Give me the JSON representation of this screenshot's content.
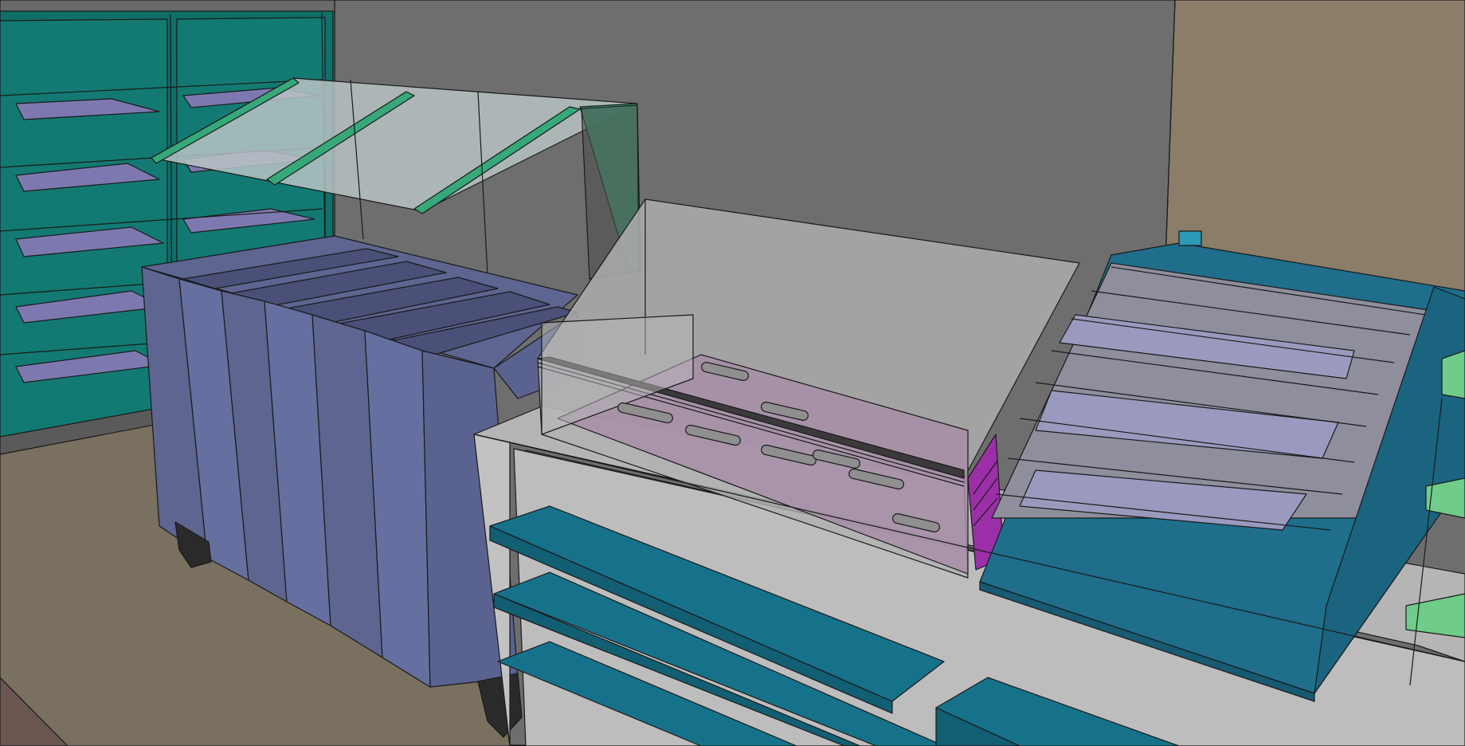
{
  "scene": {
    "description_hidden": "",
    "colors": {
      "back_wall": "#6e6e6e",
      "right_wall": "#8b7d68",
      "floor": "#7a7060",
      "fridge_glass": "#0f6f69",
      "fridge_shelf": "#7d79b0",
      "cold_well_body": "#5d6590",
      "cold_well_dark": "#4a5078",
      "sneeze_guard_frame": "#36a87a",
      "counter_top": "#b5b5b5",
      "counter_front": "#c2c2c2",
      "heated_case_glass": "#a8a8a8",
      "heated_case_tray": "#a78ea8",
      "pastry_case_body": "#1e6e8c",
      "pastry_case_glass": "#8e8e9c",
      "tray_rail": "#16728a",
      "accent_magenta": "#9b2fa8",
      "rack_green": "#6fcc8a"
    }
  }
}
